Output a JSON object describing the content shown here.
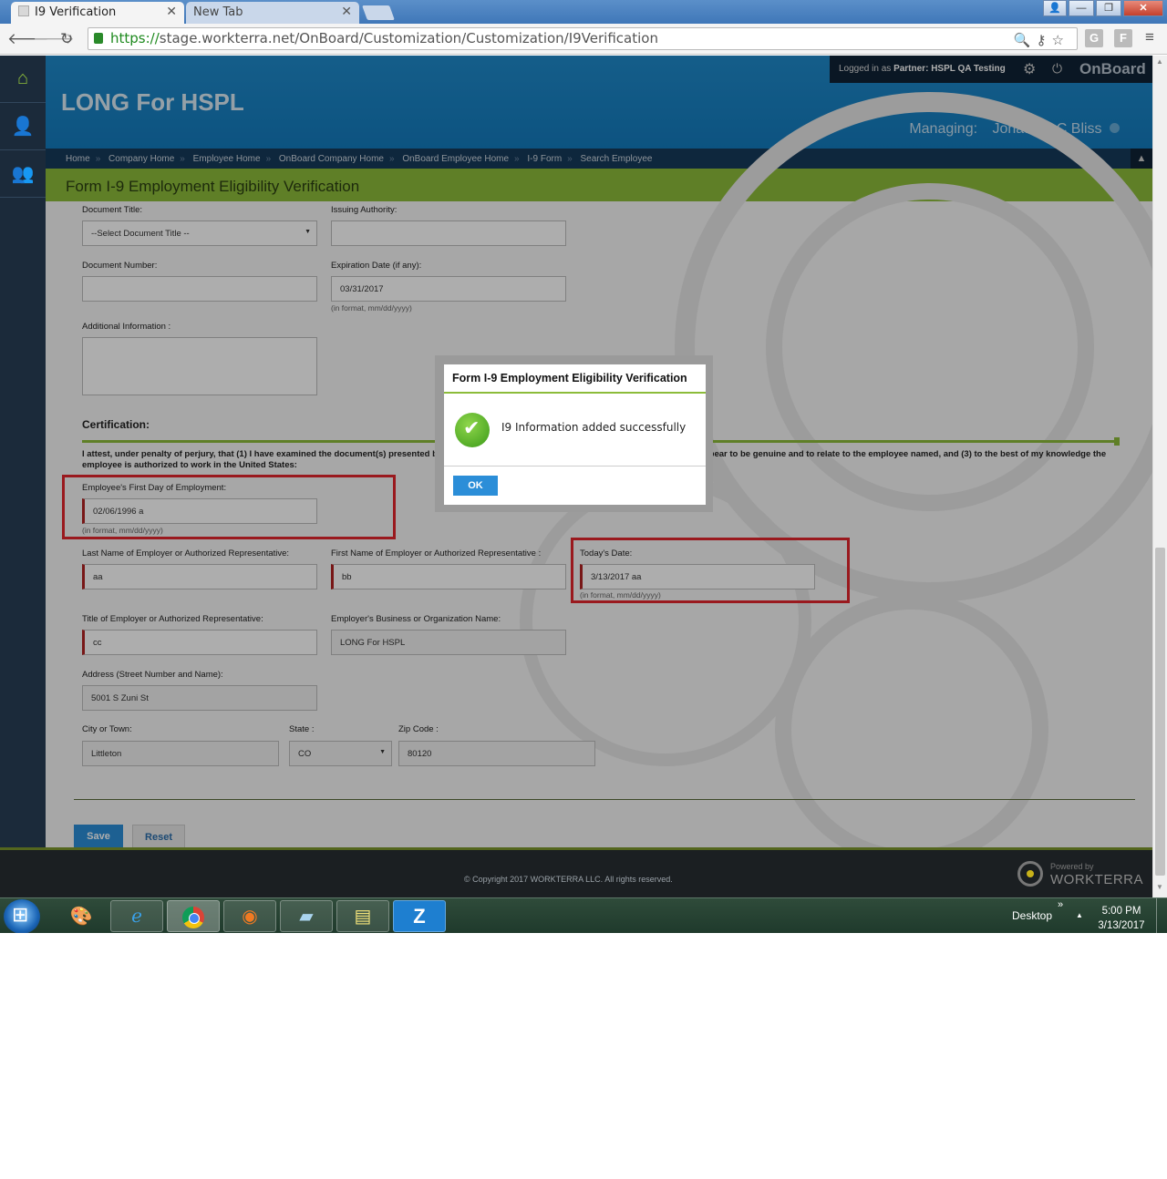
{
  "browser": {
    "active_tab_title": "I9 Verification",
    "inactive_tab_title": "New Tab",
    "url_scheme": "https://",
    "url_rest": "stage.workterra.net/OnBoard/Customization/Customization/I9Verification",
    "ext1": "G",
    "ext2": "F"
  },
  "header": {
    "company_name": "LONG For HSPL",
    "logged_in_prefix": "Logged in as",
    "logged_in_role": "Partner:",
    "logged_in_user": "HSPL QA Testing",
    "brand": "OnBoard",
    "managing_label": "Managing:",
    "managing_name": "Jonathan C Bliss"
  },
  "breadcrumb": [
    "Home",
    "Company Home",
    "Employee Home",
    "OnBoard Company Home",
    "OnBoard Employee Home",
    "I-9 Form",
    "Search Employee"
  ],
  "page_title": "Form I-9 Employment Eligibility Verification",
  "form": {
    "document_title_label": "Document Title:",
    "document_title_value": "--Select Document Title --",
    "issuing_authority_label": "Issuing Authority:",
    "document_number_label": "Document Number:",
    "expiration_label": "Expiration Date (if any):",
    "expiration_value": "03/31/2017",
    "date_format_hint": "(in format, mm/dd/yyyy)",
    "additional_info_label": "Additional Information :",
    "certification_title": "Certification:",
    "attest_text": "I attest, under penalty of perjury, that (1) I have examined the document(s) presented by the above-named employee, (2) the above-listed document(s) appear to be genuine and to relate to the employee named, and (3) to the best of my knowledge the employee is authorized to work in the United States:",
    "first_day_label": "Employee's First Day of Employment:",
    "first_day_value": "02/06/1996 a",
    "employer_last_label": "Last Name of Employer or Authorized Representative:",
    "employer_last_value": "aa",
    "employer_first_label": "First Name of Employer or Authorized Representative :",
    "employer_first_value": "bb",
    "todays_date_label": "Today's Date:",
    "todays_date_value": "3/13/2017 aa",
    "employer_title_label": "Title of Employer or Authorized Representative:",
    "employer_title_value": "cc",
    "business_name_label": "Employer's Business or Organization Name:",
    "business_name_value": "LONG For HSPL",
    "address_label": "Address (Street Number and Name):",
    "address_value": "5001 S Zuni St",
    "city_label": "City or Town:",
    "city_value": "Littleton",
    "state_label": "State :",
    "state_value": "CO",
    "zip_label": "Zip Code :",
    "zip_value": "80120",
    "save_label": "Save",
    "reset_label": "Reset"
  },
  "modal": {
    "title": "Form I-9 Employment Eligibility Verification",
    "message": "I9 Information added successfully",
    "ok_label": "OK"
  },
  "footer": {
    "copyright": "© Copyright 2017 WORKTERRA LLC. All rights reserved.",
    "powered_by": "Powered by",
    "powered_brand": "WORKTERRA"
  },
  "taskbar": {
    "z_label": "Z",
    "desktop_label": "Desktop",
    "time": "5:00 PM",
    "date": "3/13/2017"
  },
  "colors": {
    "header_blue": "#1f8acb",
    "accent_green": "#8cbc3a",
    "highlight_red": "#e3262d",
    "button_blue": "#2b8ed8"
  }
}
